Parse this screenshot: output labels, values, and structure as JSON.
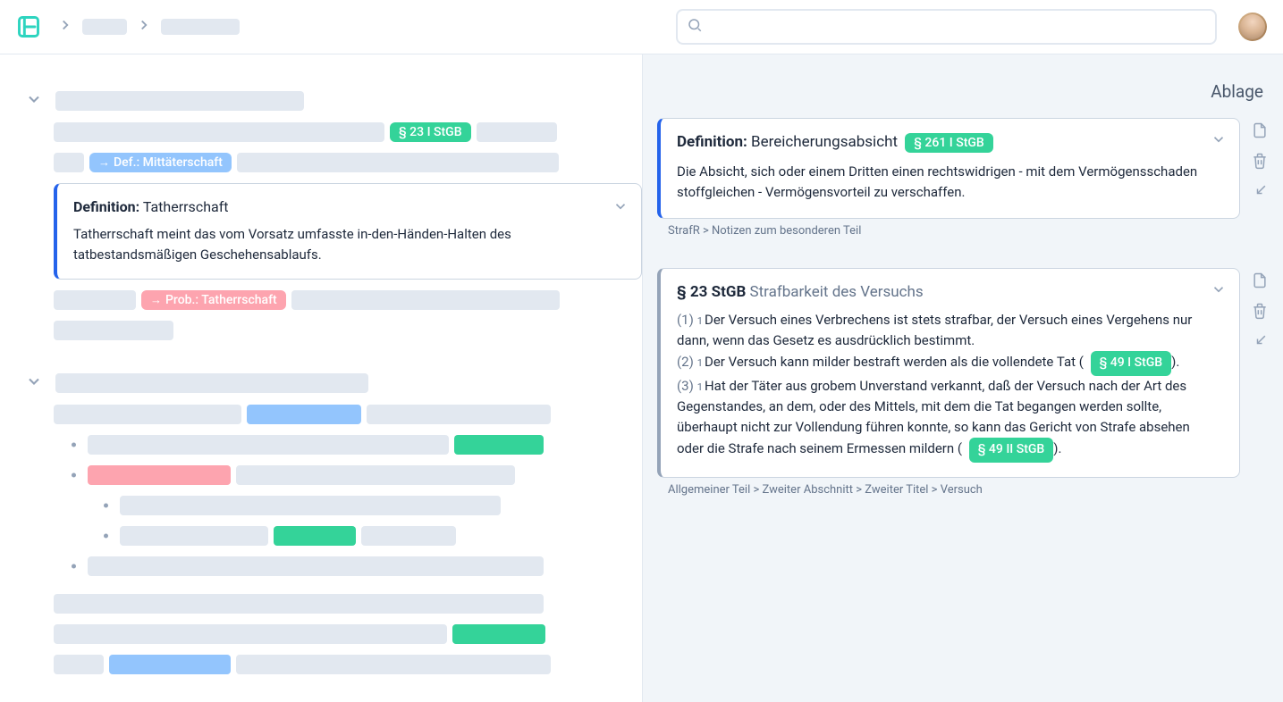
{
  "header": {
    "search_placeholder": ""
  },
  "left": {
    "tags": {
      "ref23": "§ 23 I StGB",
      "def_mit": "Def.: Mittäterschaft",
      "prob_tat": "Prob.: Tatherrschaft"
    },
    "card": {
      "title_prefix": "Definition:",
      "title_term": "Tatherrschaft",
      "body": "Tatherrschaft meint das vom Vorsatz umfasste in-den-Händen-Halten des tatbestandsmäßigen Geschehensablaufs."
    }
  },
  "right": {
    "title": "Ablage",
    "card1": {
      "title_prefix": "Definition:",
      "title_term": "Bereicherungsabsicht",
      "tag": "§ 261 I StGB",
      "body": "Die Absicht, sich oder einem Dritten einen rechtswidrigen - mit dem Vermögensschaden stoffgleichen - Vermögensvorteil zu verschaffen.",
      "breadcrumb": "StrafR > Notizen zum besonderen Teil"
    },
    "card2": {
      "title_ref": "§ 23 StGB",
      "title_text": "Strafbarkeit des Versuchs",
      "p1": {
        "num": "(1)",
        "sub": "1",
        "text": "Der Versuch eines Verbrechens ist stets strafbar, der Versuch eines Vergehens nur dann, wenn das Gesetz es ausdrücklich bestimmt."
      },
      "p2": {
        "num": "(2)",
        "sub": "1",
        "text": "Der Versuch kann milder bestraft werden als die vollendete Tat (",
        "tag": "§ 49 I StGB",
        "after": ")."
      },
      "p3": {
        "num": "(3)",
        "sub": "1",
        "text_before": "Hat der Täter aus grobem Unverstand verkannt, daß der Versuch nach der Art des Gegenstandes, an dem, oder des Mittels, mit dem die Tat begangen werden sollte, überhaupt nicht zur Vollendung führen konnte, so kann das Gericht von Strafe absehen oder die Strafe nach seinem Ermessen mildern (",
        "tag": "§ 49 II StGB",
        "after": ")."
      },
      "breadcrumb": "Allgemeiner Teil > Zweiter Abschnitt > Zweiter Titel > Versuch"
    }
  }
}
